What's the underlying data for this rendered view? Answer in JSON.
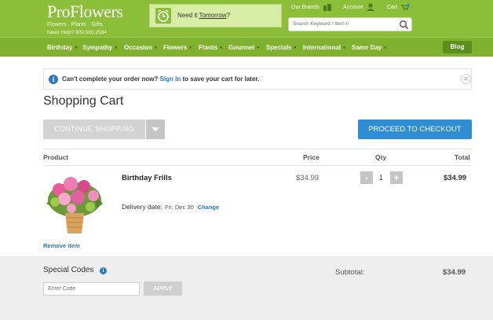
{
  "header": {
    "brand": "ProFlowers",
    "tagline": "Flowers · Plants · Gifts",
    "help": "Need Help? 800.580.2584",
    "promo_text": "Need it ",
    "promo_link": "Tomorrow",
    "promo_tail": "?",
    "our_brands": "Our Brands",
    "account": "Account",
    "cart": "Cart",
    "cart_count": "1",
    "search_placeholder": "Search Keyword / Item #"
  },
  "nav": {
    "items": [
      "Birthday",
      "Sympathy",
      "Occasion",
      "Flowers",
      "Plants",
      "Gourmet",
      "Specials",
      "International",
      "Same Day"
    ],
    "blog": "Blog"
  },
  "alert": {
    "prefix": "Can't complete your order now? ",
    "link": "Sign In",
    "suffix": " to save your cart for later."
  },
  "page": {
    "title": "Shopping Cart",
    "continue_label": "CONTINUE SHOPPING",
    "checkout_label": "PROCEED TO CHECKOUT"
  },
  "table": {
    "headers": {
      "product": "Product",
      "price": "Price",
      "qty": "Qty",
      "total": "Total"
    }
  },
  "item": {
    "name": "Birthday Frills",
    "delivery_label": "Delivery date:",
    "delivery_date": "Fri, Dec 30",
    "change": "Change",
    "price": "$34.99",
    "qty": "1",
    "minus": "-",
    "plus": "+",
    "total": "$34.99",
    "remove": "Remove item"
  },
  "footer": {
    "special_codes": "Special Codes",
    "code_placeholder": "Enter Code",
    "apply": "APPLY",
    "subtotal_label": "Subtotal:",
    "subtotal": "$34.99"
  },
  "colors": {
    "header_green": "#8cbe3a",
    "nav_green": "#7fb12f",
    "accent_blue": "#2f8dd3"
  }
}
